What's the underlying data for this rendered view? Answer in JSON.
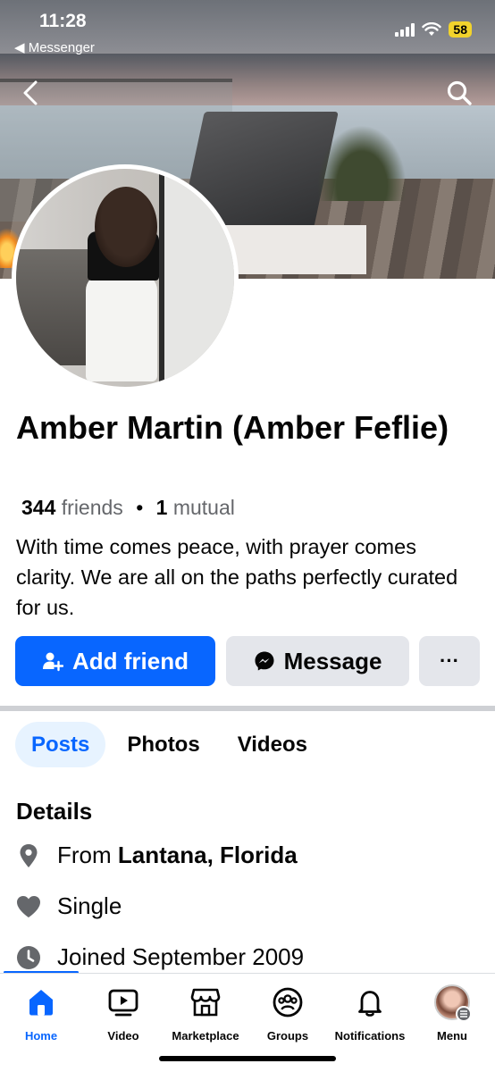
{
  "status_bar": {
    "time": "11:28",
    "back_app": "◀ Messenger",
    "battery": "58"
  },
  "cover": {
    "back_icon": "chevron-left-icon",
    "search_icon": "search-icon"
  },
  "profile": {
    "name": "Amber Martin (Amber Feflie)",
    "friends_count": "344",
    "friends_label": "friends",
    "separator": "•",
    "mutual_count": "1",
    "mutual_label": "mutual",
    "bio": "With time comes peace, with prayer comes clarity. We are all on the paths perfectly curated for us."
  },
  "actions": {
    "add_friend": "Add friend",
    "message": "Message",
    "more": "···"
  },
  "tabs": [
    {
      "label": "Posts",
      "active": true
    },
    {
      "label": "Photos",
      "active": false
    },
    {
      "label": "Videos",
      "active": false
    }
  ],
  "details": {
    "title": "Details",
    "from_prefix": "From",
    "from_place": "Lantana, Florida",
    "relationship": "Single",
    "joined": "Joined September 2009"
  },
  "bottom_nav": [
    {
      "label": "Home",
      "icon": "home-icon",
      "active": true
    },
    {
      "label": "Video",
      "icon": "video-icon",
      "active": false
    },
    {
      "label": "Marketplace",
      "icon": "marketplace-icon",
      "active": false
    },
    {
      "label": "Groups",
      "icon": "groups-icon",
      "active": false
    },
    {
      "label": "Notifications",
      "icon": "bell-icon",
      "active": false
    },
    {
      "label": "Menu",
      "icon": "avatar-menu-icon",
      "active": false
    }
  ],
  "colors": {
    "accent": "#0866ff",
    "secondary_button": "#e4e6eb",
    "active_tab_bg": "#e7f3ff",
    "muted_text": "#65676b",
    "battery": "#f2d32c"
  }
}
